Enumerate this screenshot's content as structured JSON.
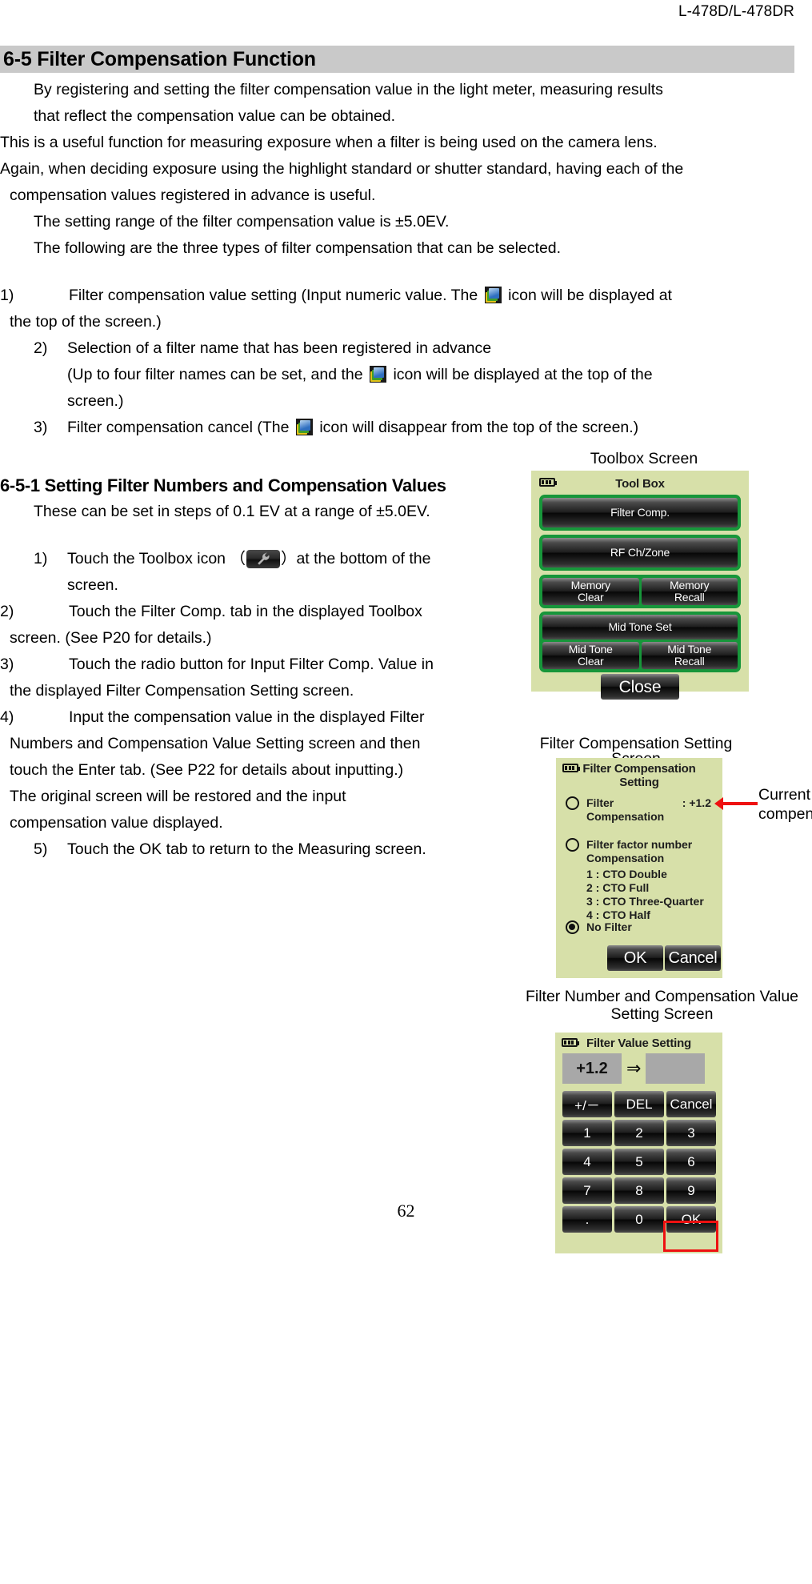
{
  "header": {
    "model": "L-478D/L-478DR"
  },
  "section": {
    "number_title": "6-5 Filter Compensation Function"
  },
  "intro": {
    "line1": "By registering and setting the filter compensation value in the light meter, measuring results",
    "line2": "that reflect the compensation value can be obtained.",
    "line3": "This is a useful function for measuring exposure when a filter is being used on the camera lens.",
    "line4": "Again, when deciding exposure using the highlight standard or shutter standard, having each of the",
    "line5": "compensation values registered in advance is useful.",
    "line6": "The setting range of the filter compensation value is  ±5.0EV.",
    "line7": "The following are the three types of filter compensation that can be selected."
  },
  "types": [
    {
      "num": "1)",
      "part_a": "Filter compensation value setting (Input numeric value. The",
      "part_b": "icon will be displayed at",
      "cont": "the top of the screen.)"
    },
    {
      "num": "2)",
      "part_a": "Selection of a filter name that has been registered in advance",
      "sub_a": "(Up to four filter names can be set, and the",
      "sub_b": "icon will be displayed at the top of the",
      "sub_c": "screen.)"
    },
    {
      "num": "3)",
      "part_a": "Filter compensation cancel (The",
      "part_b": "icon will disappear from the top of the screen.)"
    }
  ],
  "subsection": {
    "title": "6-5-1 Setting Filter Numbers and Compensation Values",
    "note": "These can be set in steps of 0.1 EV at a range of  ±5.0EV."
  },
  "steps": [
    {
      "num": "1)",
      "a": "Touch the Toolbox icon （",
      "b": "）at the bottom of the",
      "cont": "screen."
    },
    {
      "num": "2)",
      "a": "Touch the Filter Comp. tab in the displayed Toolbox",
      "cont": "screen. (See P20 for details.)"
    },
    {
      "num": "3)",
      "a": "Touch the radio button for Input Filter Comp. Value in",
      "cont": "the displayed Filter Compensation Setting screen."
    },
    {
      "num": "4)",
      "a": "Input the compensation value in the displayed Filter",
      "cont": "Numbers and Compensation Value Setting screen and then",
      "cont2": "touch the Enter tab. (See P22 for details about inputting.)",
      "cont3": "The original screen will be restored and the input",
      "cont4": "compensation value displayed."
    },
    {
      "num": "5)",
      "a": "Touch the OK tab to return to the Measuring screen."
    }
  ],
  "figures": {
    "toolbox": {
      "caption": "Toolbox Screen",
      "lcd_title": "Tool Box",
      "buttons": {
        "filter_comp": "Filter Comp.",
        "rf_ch_zone": "RF Ch/Zone",
        "memory_clear": "Memory\nClear",
        "memory_recall": "Memory\nRecall",
        "mid_tone_set": "Mid Tone Set",
        "mid_tone_clear": "Mid Tone\nClear",
        "mid_tone_recall": "Mid Tone\nRecall",
        "close": "Close"
      }
    },
    "filter_compensation": {
      "caption_line1": "Filter Compensation Setting",
      "caption_line2": "Screen",
      "lcd_title_line1": "Filter Compensation",
      "lcd_title_line2": "Setting",
      "option1_label_line1": "Filter",
      "option1_label_line2": "Compensation",
      "option1_value": ": +1.2",
      "option2_label_line1": "Filter factor number",
      "option2_label_line2": "Compensation",
      "option2_items": [
        "1 : CTO Double",
        "2 : CTO Full",
        "3 : CTO Three-Quarter",
        "4 : CTO Half"
      ],
      "option3_label": "No Filter",
      "ok": "OK",
      "cancel": "Cancel",
      "annotation_line1": "Current filter",
      "annotation_line2": "compensatio"
    },
    "filter_value": {
      "caption_line1": "Filter Number and Compensation Value",
      "caption_line2": "Setting Screen",
      "lcd_title": "Filter Value Setting",
      "current_value": "+1.2",
      "arrow": "⇒",
      "new_value": "",
      "keys": [
        "+/－",
        "DEL",
        "Cancel",
        "1",
        "2",
        "3",
        "4",
        "5",
        "6",
        "7",
        "8",
        "9",
        ".",
        "0",
        "OK"
      ]
    }
  },
  "page_number": "62",
  "colors": {
    "lcd_background": "#d7e0a9",
    "green_frame": "#17963a",
    "highlight_red": "#ee1111",
    "heading_bar": "#c9c9c9"
  }
}
